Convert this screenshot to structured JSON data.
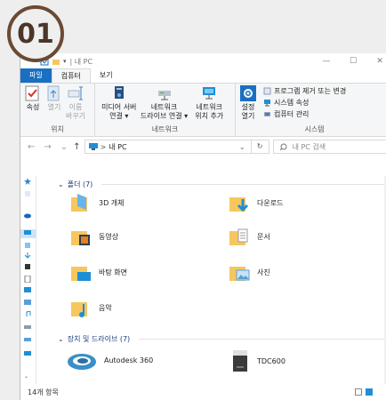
{
  "step_badge": "01",
  "window": {
    "title": "| 내 PC",
    "controls": [
      "—",
      "☐",
      "✕"
    ]
  },
  "tabs": [
    "파일",
    "컴퓨터",
    "보기"
  ],
  "ribbon": {
    "location": {
      "label": "위치",
      "buttons": [
        {
          "label": "속성",
          "dim": false
        },
        {
          "label": "열기",
          "dim": true
        },
        {
          "label": "이름\n바꾸기",
          "dim": true
        }
      ]
    },
    "network": {
      "label": "네트워크",
      "buttons": [
        "미디어 서버\n연결 ▾",
        "네트워크\n드라이브 연결 ▾",
        "네트워크\n위치 추가"
      ]
    },
    "system": {
      "label": "시스템",
      "settings": "설정\n열기",
      "items": [
        "프로그램 제거 또는 변경",
        "시스템 속성",
        "컴퓨터 관리"
      ]
    }
  },
  "address": {
    "back": "←",
    "forward": "→",
    "recent": "⌄",
    "up": "↑",
    "path_sep": ">",
    "path": "내 PC",
    "dropdown": "⌄",
    "refresh": "↻",
    "search_placeholder": "내 PC 검색"
  },
  "folders": {
    "header": "폴더 (7)",
    "items": [
      "3D 개체",
      "다운로드",
      "동영상",
      "문서",
      "바탕 화면",
      "사진",
      "음악"
    ]
  },
  "drives": {
    "header": "장치 및 드라이브 (7)",
    "items": [
      "Autodesk 360",
      "TDC600"
    ]
  },
  "status": {
    "count": "14개 항목"
  },
  "colors": {
    "accent": "#1a6fc2",
    "folder": "#f6c75e",
    "badge_ring": "#6b4a33"
  }
}
